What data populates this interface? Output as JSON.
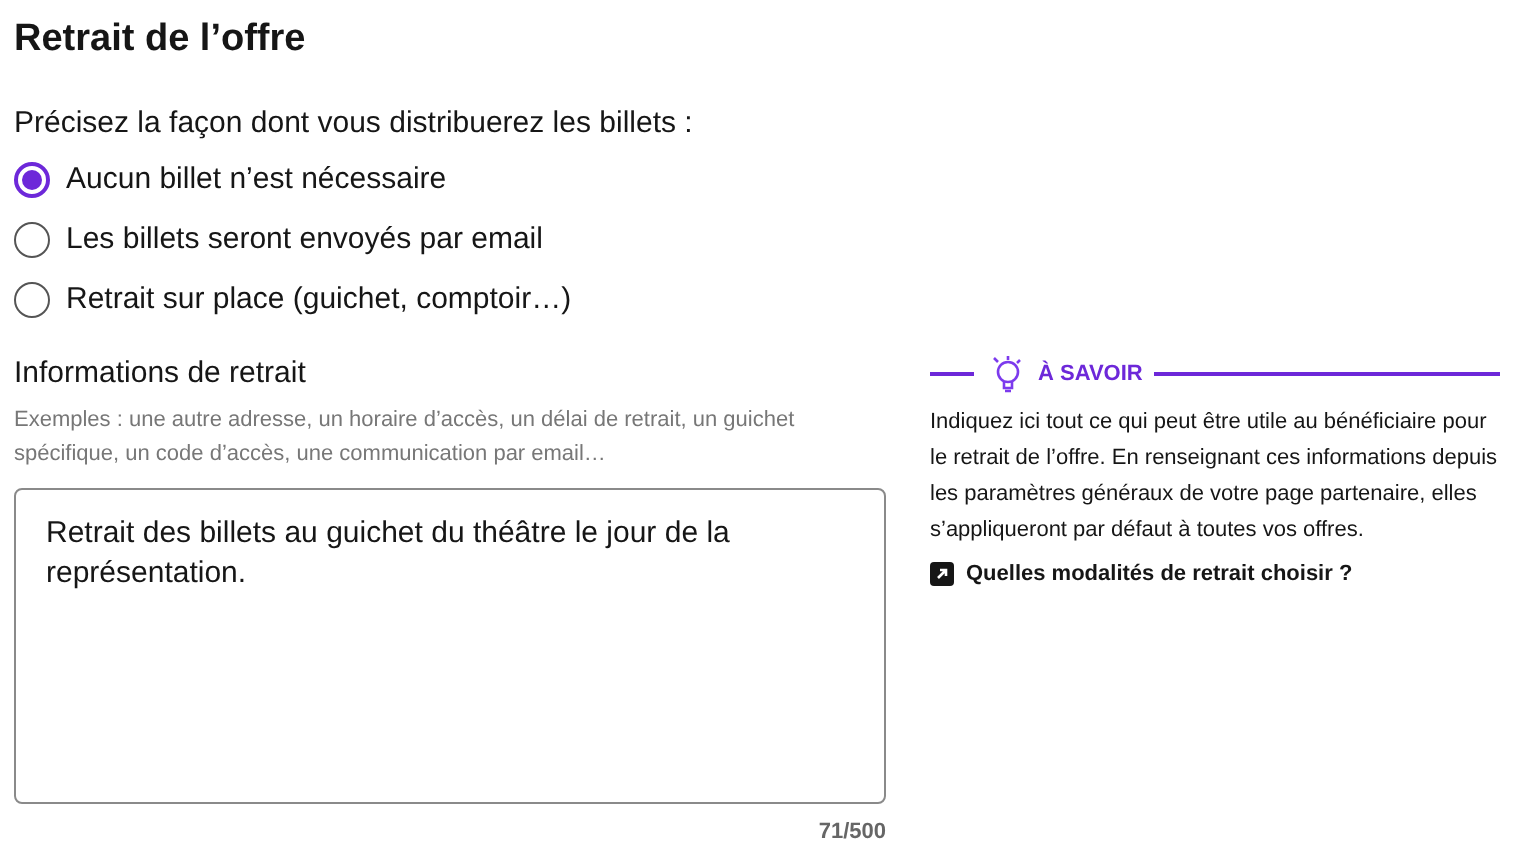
{
  "title": "Retrait de l’offre",
  "question": "Précisez la façon dont vous distribuerez les billets :",
  "options": [
    {
      "label": "Aucun billet n’est nécessaire",
      "selected": true
    },
    {
      "label": "Les billets seront envoyés par email",
      "selected": false
    },
    {
      "label": "Retrait sur place (guichet, comptoir…)",
      "selected": false
    }
  ],
  "field": {
    "label": "Informations de retrait",
    "description": "Exemples : une autre adresse, un horaire d’accès, un délai de retrait, un guichet spécifique, un code d’accès, une communication par email…",
    "value": "Retrait des billets au guichet du théâtre le jour de la représentation.",
    "counter": "71/500"
  },
  "tip": {
    "heading": "À SAVOIR",
    "text": "Indiquez ici tout ce qui peut être utile au bénéficiaire pour le retrait de l’offre. En renseignant ces informations depuis les paramètres généraux de votre page partenaire, elles s’appliqueront par défaut à toutes vos offres.",
    "link": "Quelles modalités de retrait choisir ?"
  }
}
